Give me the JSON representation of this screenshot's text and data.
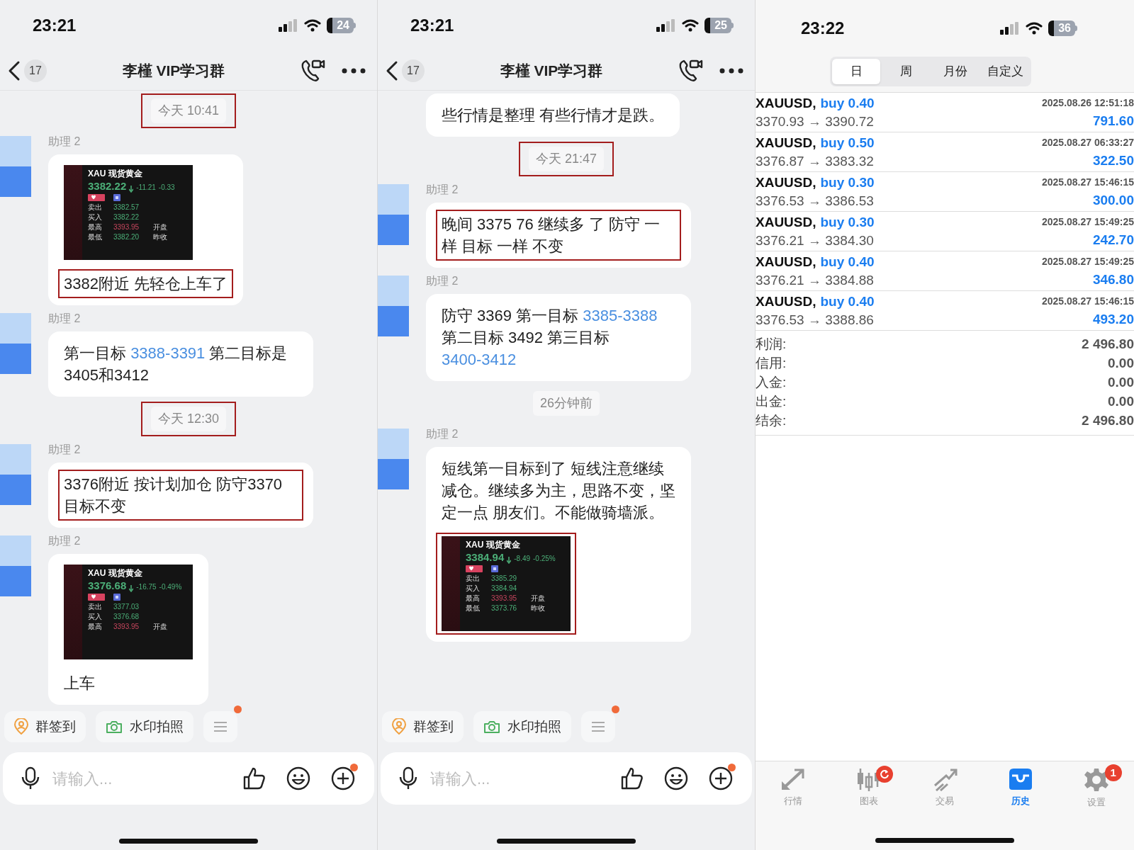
{
  "panels": [
    {
      "kind": "chat",
      "status_bar": {
        "time": "23:21",
        "battery": "24"
      },
      "header": {
        "back_count": "17",
        "title": "李槿 VIP学习群"
      },
      "messages": [
        {
          "kind": "time",
          "text": "今天 10:41",
          "highlighted": true
        },
        {
          "kind": "message",
          "sender": "助理 2",
          "blocks": [
            {
              "kind": "image",
              "highlighted": false,
              "title": "XAU 现货黄金",
              "price": "3382.22",
              "change": "-11.21",
              "change_pct": "-0.33",
              "rows": [
                {
                  "label": "卖出",
                  "value": "3382.57",
                  "color": "#4caf78"
                },
                {
                  "label": "买入",
                  "value": "3382.22",
                  "color": "#4caf78"
                },
                {
                  "label": "最高",
                  "value": "3393.95",
                  "note": "开盘",
                  "color": "#c8465e"
                },
                {
                  "label": "最低",
                  "value": "3382.20",
                  "note": "昨收",
                  "color": "#4caf78"
                }
              ]
            },
            {
              "kind": "text",
              "highlighted": true,
              "parts": [
                {
                  "text": "3382附近 先轻仓上车了",
                  "link": false
                }
              ]
            }
          ]
        },
        {
          "kind": "message",
          "sender": "助理 2",
          "blocks": [
            {
              "kind": "text",
              "highlighted": false,
              "parts": [
                {
                  "text": "第一目标 ",
                  "link": false
                },
                {
                  "text": "3388-3391",
                  "link": true
                },
                {
                  "text": " 第二目标是3405和3412",
                  "link": false
                }
              ]
            }
          ]
        },
        {
          "kind": "time",
          "text": "今天 12:30",
          "highlighted": true
        },
        {
          "kind": "message",
          "sender": "助理 2",
          "blocks": [
            {
              "kind": "text",
              "highlighted": true,
              "parts": [
                {
                  "text": "3376附近 按计划加仓  防守3370  目标不变",
                  "link": false
                }
              ]
            }
          ]
        },
        {
          "kind": "message",
          "sender": "助理 2",
          "blocks": [
            {
              "kind": "image",
              "highlighted": false,
              "title": "XAU 现货黄金",
              "price": "3376.68",
              "change": "-16.75",
              "change_pct": "-0.49%",
              "rows": [
                {
                  "label": "卖出",
                  "value": "3377.03",
                  "color": "#4caf78"
                },
                {
                  "label": "买入",
                  "value": "3376.68",
                  "color": "#4caf78"
                },
                {
                  "label": "最高",
                  "value": "3393.95",
                  "note": "开盘",
                  "color": "#c8465e"
                }
              ]
            },
            {
              "kind": "text",
              "highlighted": false,
              "parts": [
                {
                  "text": "上车",
                  "link": false
                }
              ]
            }
          ]
        }
      ],
      "quick_actions": [
        {
          "kind": "checkin",
          "label": "群签到"
        },
        {
          "kind": "camera",
          "label": "水印拍照"
        },
        {
          "kind": "menu",
          "dot": true
        }
      ],
      "input": {
        "placeholder": "请输入..."
      }
    },
    {
      "kind": "chat",
      "status_bar": {
        "time": "23:21",
        "battery": "25"
      },
      "header": {
        "back_count": "17",
        "title": "李槿 VIP学习群"
      },
      "messages": [
        {
          "kind": "message",
          "blocks": [
            {
              "kind": "text",
              "highlighted": false,
              "parts": [
                {
                  "text": "些行情是整理 有些行情才是跌。",
                  "link": false
                }
              ]
            }
          ]
        },
        {
          "kind": "time",
          "text": "今天 21:47",
          "highlighted": true
        },
        {
          "kind": "message",
          "sender": "助理 2",
          "blocks": [
            {
              "kind": "text",
              "highlighted": true,
              "parts": [
                {
                  "text": "晚间 3375 76 继续多 了 防守 一样  目标 一样 不变",
                  "link": false
                }
              ]
            }
          ]
        },
        {
          "kind": "message",
          "sender": "助理 2",
          "blocks": [
            {
              "kind": "text",
              "highlighted": false,
              "parts": [
                {
                  "text": "防守 3369  第一目标 ",
                  "link": false
                },
                {
                  "text": "3385-3388",
                  "link": true
                },
                {
                  "text": "  第二目标 3492  第三目标 ",
                  "link": false
                },
                {
                  "text": "3400-3412",
                  "link": true
                }
              ]
            }
          ]
        },
        {
          "kind": "time",
          "text": "26分钟前",
          "highlighted": false
        },
        {
          "kind": "message",
          "sender": "助理 2",
          "blocks": [
            {
              "kind": "text",
              "highlighted": false,
              "parts": [
                {
                  "text": "短线第一目标到了  短线注意继续减仓。继续多为主，思路不变，坚定一点 朋友们。不能做骑墙派。",
                  "link": false
                }
              ]
            },
            {
              "kind": "image",
              "highlighted": true,
              "title": "XAU 现货黄金",
              "price": "3384.94",
              "change": "-8.49",
              "change_pct": "-0.25%",
              "rows": [
                {
                  "label": "卖出",
                  "value": "3385.29",
                  "color": "#4caf78"
                },
                {
                  "label": "买入",
                  "value": "3384.94",
                  "color": "#4caf78"
                },
                {
                  "label": "最高",
                  "value": "3393.95",
                  "note": "开盘",
                  "color": "#c8465e"
                },
                {
                  "label": "最低",
                  "value": "3373.76",
                  "note": "昨收",
                  "color": "#4caf78"
                }
              ]
            }
          ]
        }
      ],
      "quick_actions": [
        {
          "kind": "checkin",
          "label": "群签到"
        },
        {
          "kind": "camera",
          "label": "水印拍照"
        },
        {
          "kind": "menu",
          "dot": true
        }
      ],
      "input": {
        "placeholder": "请输入..."
      }
    },
    {
      "kind": "history",
      "status_bar": {
        "time": "23:22",
        "battery": "36"
      },
      "tabs": [
        {
          "label": "日",
          "selected": true
        },
        {
          "label": "周",
          "selected": false
        },
        {
          "label": "月份",
          "selected": false
        },
        {
          "label": "自定义",
          "selected": false
        }
      ],
      "trades": [
        {
          "symbol": "XAUUSD,",
          "side": "buy 0.40",
          "time": "2025.08.26 12:51:18",
          "prices": "3370.93 → 3390.72",
          "profit": "791.60"
        },
        {
          "symbol": "XAUUSD,",
          "side": "buy 0.50",
          "time": "2025.08.27 06:33:27",
          "prices": "3376.87 → 3383.32",
          "profit": "322.50"
        },
        {
          "symbol": "XAUUSD,",
          "side": "buy 0.30",
          "time": "2025.08.27 15:46:15",
          "prices": "3376.53 → 3386.53",
          "profit": "300.00"
        },
        {
          "symbol": "XAUUSD,",
          "side": "buy 0.30",
          "time": "2025.08.27 15:49:25",
          "prices": "3376.21 → 3384.30",
          "profit": "242.70"
        },
        {
          "symbol": "XAUUSD,",
          "side": "buy 0.40",
          "time": "2025.08.27 15:49:25",
          "prices": "3376.21 → 3384.88",
          "profit": "346.80"
        },
        {
          "symbol": "XAUUSD,",
          "side": "buy 0.40",
          "time": "2025.08.27 15:46:15",
          "prices": "3376.53 → 3388.86",
          "profit": "493.20"
        }
      ],
      "summary": [
        {
          "label": "利润:",
          "value": "2 496.80"
        },
        {
          "label": "信用:",
          "value": "0.00"
        },
        {
          "label": "入金:",
          "value": "0.00"
        },
        {
          "label": "出金:",
          "value": "0.00"
        },
        {
          "label": "结余:",
          "value": "2 496.80"
        }
      ],
      "nav": [
        {
          "kind": "quotes",
          "label": "行情",
          "selected": false
        },
        {
          "kind": "chart",
          "label": "图表",
          "selected": false,
          "refresh_badge": true
        },
        {
          "kind": "trade",
          "label": "交易",
          "selected": false
        },
        {
          "kind": "history",
          "label": "历史",
          "selected": true
        },
        {
          "kind": "settings",
          "label": "设置",
          "selected": false,
          "badge": "1"
        }
      ]
    }
  ]
}
